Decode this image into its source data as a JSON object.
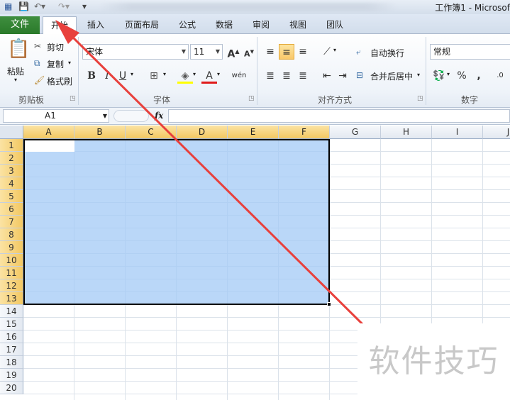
{
  "window": {
    "title": "工作簿1 - Microsof"
  },
  "tabs": [
    {
      "label": "文件"
    },
    {
      "label": "开始"
    },
    {
      "label": "插入"
    },
    {
      "label": "页面布局"
    },
    {
      "label": "公式"
    },
    {
      "label": "数据"
    },
    {
      "label": "审阅"
    },
    {
      "label": "视图"
    },
    {
      "label": "团队"
    }
  ],
  "clipboard": {
    "paste": "粘贴",
    "cut": "剪切",
    "copy": "复制",
    "format_painter": "格式刷",
    "group_label": "剪贴板"
  },
  "font": {
    "name": "宋体",
    "size": "11",
    "bold": "B",
    "italic": "I",
    "underline": "U",
    "group_label": "字体"
  },
  "alignment": {
    "wrap": "自动换行",
    "merge": "合并后居中",
    "group_label": "对齐方式"
  },
  "number": {
    "format": "常规",
    "percent": "%",
    "comma": ",",
    "group_label": "数字"
  },
  "formula_bar": {
    "name_box": "A1",
    "fx": "fx",
    "value": ""
  },
  "columns": [
    "A",
    "B",
    "C",
    "D",
    "E",
    "F",
    "G",
    "H",
    "I",
    "J"
  ],
  "rows": [
    "1",
    "2",
    "3",
    "4",
    "5",
    "6",
    "7",
    "8",
    "9",
    "10",
    "11",
    "12",
    "13",
    "14",
    "15",
    "16",
    "17",
    "18",
    "19",
    "20"
  ],
  "selection": {
    "range": "A1:F13",
    "fill_color": "#a3c9f5"
  },
  "annotation": {
    "color": "#e8403c"
  },
  "watermark": "软件技巧",
  "colors": {
    "file_tab": "#2a7a2a",
    "header_selected": "#f3c862"
  }
}
